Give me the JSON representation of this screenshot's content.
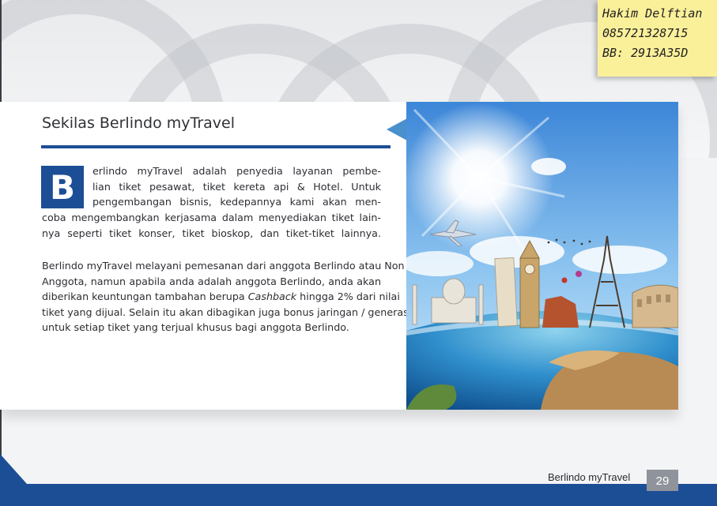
{
  "page": {
    "title": "Sekilas Berlindo myTravel",
    "dropcap": "B",
    "para1_a": [
      "erlindo   myTravel   adalah   penyedia   layanan   pembe-",
      "lian  tiket  pesawat,  tiket  kereta  api  &  Hotel.  Untuk",
      "pengembangan  bisnis,  kedepannya  kami  akan  men-"
    ],
    "para1_b": [
      "coba  mengembangkan  kerjasama  dalam  menyediakan  tiket  lain-",
      "nya   seperti   tiket   konser,   tiket   bioskop,   dan   tiket-tiket   lainnya."
    ],
    "para2": {
      "line1": "Berlindo myTravel melayani pemesanan dari anggota Berlindo atau Non",
      "line2": "Anggota, namun apabila anda adalah anggota Berlindo,  anda akan",
      "line3_pre": "diberikan keuntungan tambahan berupa ",
      "line3_em": "Cashback",
      "line3_post": " hingga 2% dari nilai",
      "line4": "tiket yang dijual. Selain itu akan dibagikan juga bonus jaringan / generasi",
      "line5": "untuk setiap tiket yang terjual khusus bagi anggota Berlindo."
    },
    "footer_brand": "Berlindo myTravel",
    "page_number": "29"
  },
  "sticky_note": {
    "line1": "Hakim Delftian",
    "line2": "085721328715",
    "line3": "BB: 2913A35D"
  },
  "photo": {
    "description_icon": "travel-landmarks-globe-image"
  },
  "colors": {
    "accent_blue": "#1c4e95",
    "note_yellow": "#fbf09a",
    "page_num_gray": "#8f939b"
  }
}
